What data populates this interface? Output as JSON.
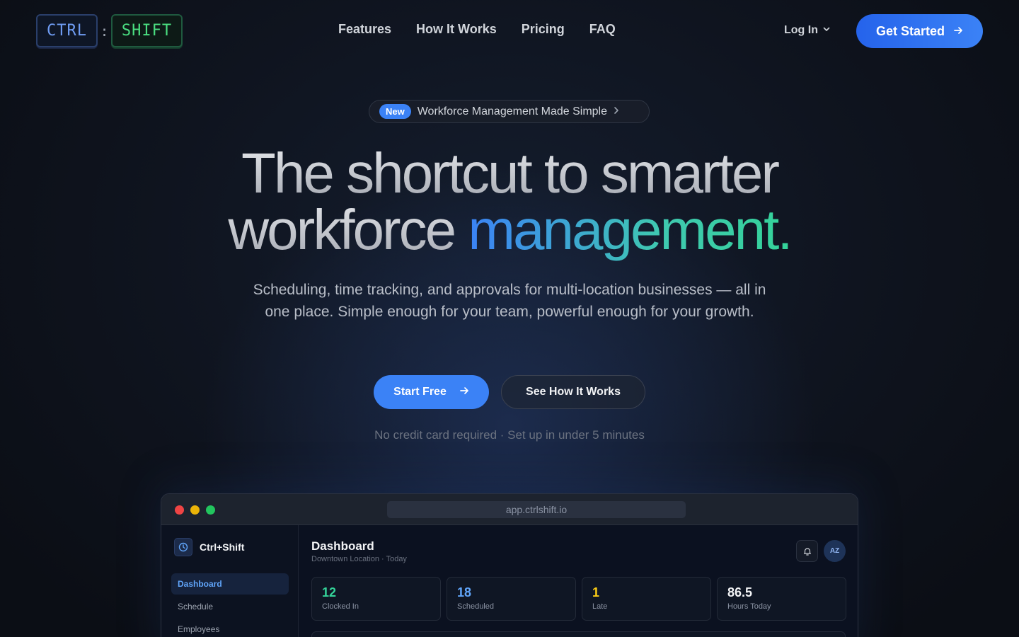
{
  "nav": {
    "logo": {
      "left": "CTRL",
      "sep": ":",
      "right": "SHIFT"
    },
    "links": [
      "Features",
      "How It Works",
      "Pricing",
      "FAQ"
    ],
    "login": "Log In",
    "cta": "Get Started"
  },
  "badge": {
    "tag": "New",
    "text": "Workforce Management Made Simple"
  },
  "hero": {
    "line1": "The shortcut to smarter",
    "line2_plain": "workforce ",
    "line2_accent": "management.",
    "subtitle": "Scheduling, time tracking, and approvals for multi-location businesses — all in one place. Simple enough for your team, powerful enough for your growth.",
    "primary_button": "Start Free",
    "secondary_button": "See How It Works",
    "note": "No credit card required · Set up in under 5 minutes"
  },
  "app": {
    "url": "app.ctrlshift.io",
    "brand": "Ctrl+Shift",
    "sidebar": [
      "Dashboard",
      "Schedule",
      "Employees"
    ],
    "dashboard": {
      "title": "Dashboard",
      "subtitle": "Downtown Location · Today",
      "avatar": "AZ",
      "stats": [
        {
          "value": "12",
          "label": "Clocked In",
          "color": "#34d399"
        },
        {
          "value": "18",
          "label": "Scheduled",
          "color": "#60a5fa"
        },
        {
          "value": "1",
          "label": "Late",
          "color": "#facc15"
        },
        {
          "value": "86.5",
          "label": "Hours Today",
          "color": "#f3f4f6"
        }
      ]
    }
  },
  "colors": {
    "accent": "#3b82f6",
    "teal": "#34d399"
  },
  "icons": {
    "login_chevron": "chevron-down-icon",
    "cta_arrow": "arrow-right-icon",
    "bell": "bell-icon",
    "brand": "clock-icon"
  }
}
